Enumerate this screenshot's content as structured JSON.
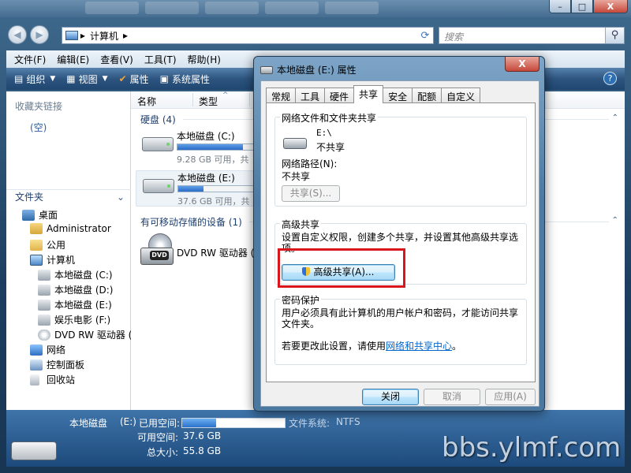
{
  "window": {
    "close_glyph": "X",
    "max_glyph": "□",
    "min_glyph": "–"
  },
  "address": {
    "back_glyph": "◀",
    "forward_glyph": "▶",
    "path_sep": "▸",
    "path": "计算机",
    "search_placeholder": "搜索"
  },
  "menu": [
    "文件(F)",
    "编辑(E)",
    "查看(V)",
    "工具(T)",
    "帮助(H)"
  ],
  "toolbar": {
    "organize": "组织",
    "views": "视图",
    "properties": "属性",
    "system_properties": "系统属性",
    "help_glyph": "?"
  },
  "navpane": {
    "favorites_header": "收藏夹链接",
    "favorites_empty": "(空)",
    "folders_header": "文件夹",
    "tree": [
      "桌面",
      "Administrator",
      "公用",
      "计算机",
      "本地磁盘 (C:)",
      "本地磁盘 (D:)",
      "本地磁盘 (E:)",
      "娱乐电影 (F:)",
      "DVD RW 驱动器 (",
      "网络",
      "控制面板",
      "回收站"
    ]
  },
  "content": {
    "columns": [
      "名称",
      "类型"
    ],
    "group_hdd": "硬盘 (4)",
    "group_removable": "有可移动存储的设备 (1)",
    "drives": [
      {
        "name": "本地磁盘 (C:)",
        "free": "9.28 GB 可用，共",
        "fill": 0.85
      },
      {
        "name": "本地磁盘 (E:)",
        "free": "37.6 GB 可用，共",
        "fill": 0.33
      }
    ],
    "dvd": "DVD RW 驱动器 (",
    "dvd_label": "DVD"
  },
  "details": {
    "name": "本地磁盘",
    "drive_letter": "(E:)",
    "used_label": "已用空间:",
    "used_fill": 0.33,
    "free_label": "可用空间:",
    "free_value": "37.6 GB",
    "total_label": "总大小:",
    "total_value": "55.8 GB",
    "fs_label": "文件系统:",
    "fs_value": "NTFS"
  },
  "watermark": "bbs.ylmf.com",
  "dialog": {
    "title": "本地磁盘 (E:) 属性",
    "close_glyph": "X",
    "tabs": [
      "常规",
      "工具",
      "硬件",
      "共享",
      "安全",
      "配额",
      "自定义"
    ],
    "active_tab": "共享",
    "share_group": {
      "title": "网络文件和文件夹共享",
      "path": "E:\\",
      "status": "不共享",
      "net_path_label": "网络路径(N):",
      "net_path_value": "不共享",
      "share_button": "共享(S)..."
    },
    "advanced_group": {
      "title": "高级共享",
      "description": "设置自定义权限，创建多个共享，并设置其他高级共享选项。",
      "button": "高级共享(A)..."
    },
    "password_group": {
      "title": "密码保护",
      "description": "用户必须具有此计算机的用户帐户和密码，才能访问共享文件夹。",
      "change_prefix": "若要更改此设置，请使用",
      "change_link": "网络和共享中心",
      "change_suffix": "。"
    },
    "buttons": {
      "close": "关闭",
      "cancel": "取消",
      "apply": "应用(A)"
    }
  }
}
